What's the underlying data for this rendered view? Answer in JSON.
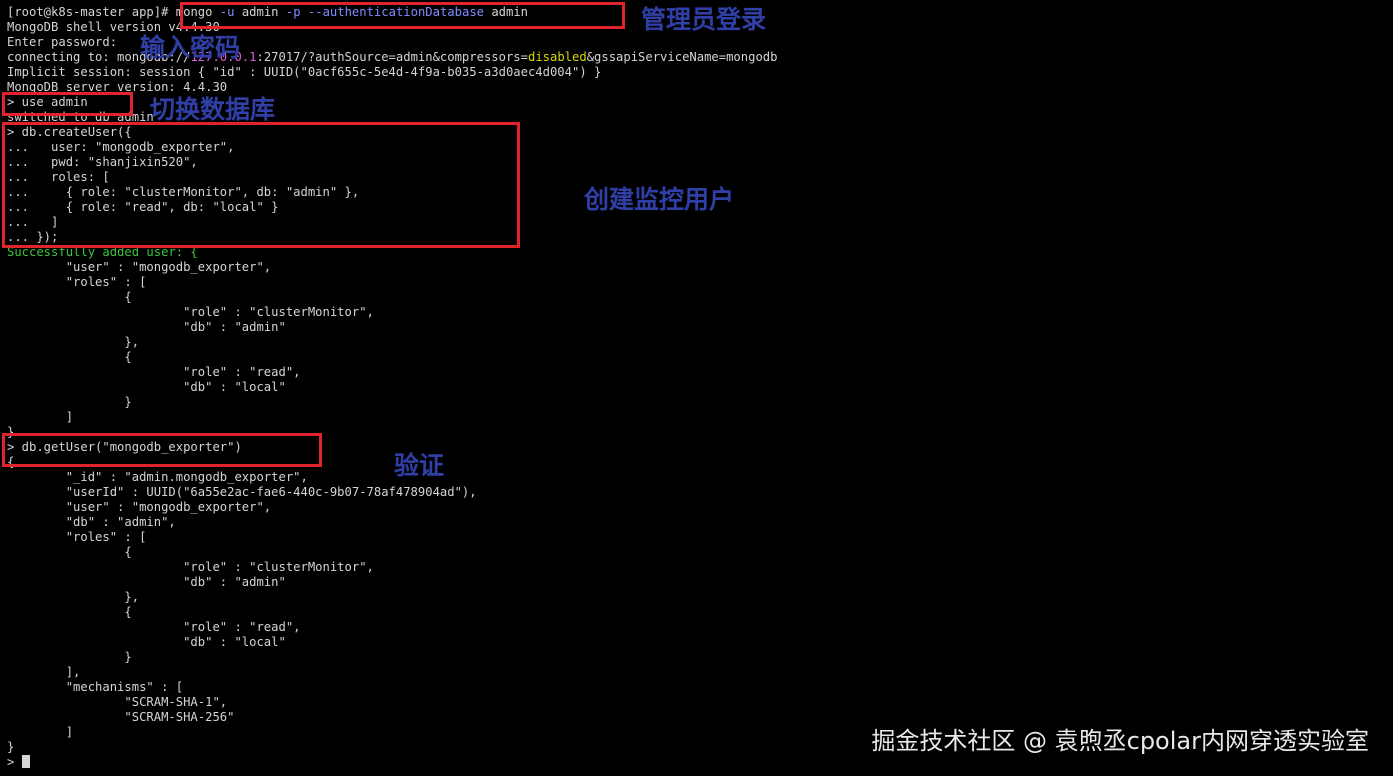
{
  "terminal": {
    "lines": [
      [
        {
          "t": "[root@k8s-master app]# "
        },
        {
          "t": "mongo "
        },
        {
          "t": "-u",
          "c": "blue"
        },
        {
          "t": " admin "
        },
        {
          "t": "-p",
          "c": "blue"
        },
        {
          "t": " "
        },
        {
          "t": "--authenticationDatabase",
          "c": "blue"
        },
        {
          "t": " admin"
        }
      ],
      [
        {
          "t": "MongoDB shell version v4.4.30"
        }
      ],
      [
        {
          "t": "Enter password:"
        }
      ],
      [
        {
          "t": "connecting to: mongodb://"
        },
        {
          "t": "127.0.0.1",
          "c": "magenta"
        },
        {
          "t": ":27017/?authSource=admin&compressors="
        },
        {
          "t": "disabled",
          "c": "yellow"
        },
        {
          "t": "&gssapiServiceName=mongodb"
        }
      ],
      [
        {
          "t": "Implicit session: session { \"id\" : UUID(\"0acf655c-5e4d-4f9a-b035-a3d0aec4d004\") }"
        }
      ],
      [
        {
          "t": "MongoDB server version: 4.4.30"
        }
      ],
      [
        {
          "t": "> use admin"
        }
      ],
      [
        {
          "t": "switched to db admin"
        }
      ],
      [
        {
          "t": "> db.createUser({"
        }
      ],
      [
        {
          "t": "...   user: \"mongodb_exporter\","
        }
      ],
      [
        {
          "t": "...   pwd: \"shanjixin520\","
        }
      ],
      [
        {
          "t": "...   roles: ["
        }
      ],
      [
        {
          "t": "...     { role: \"clusterMonitor\", db: \"admin\" },"
        }
      ],
      [
        {
          "t": "...     { role: \"read\", db: \"local\" }"
        }
      ],
      [
        {
          "t": "...   ]"
        }
      ],
      [
        {
          "t": "... });"
        }
      ],
      [
        {
          "t": "Successfully added user: {",
          "c": "green"
        }
      ],
      [
        {
          "t": "        \"user\" : \"mongodb_exporter\","
        }
      ],
      [
        {
          "t": "        \"roles\" : ["
        }
      ],
      [
        {
          "t": "                {"
        }
      ],
      [
        {
          "t": "                        \"role\" : \"clusterMonitor\","
        }
      ],
      [
        {
          "t": "                        \"db\" : \"admin\""
        }
      ],
      [
        {
          "t": "                },"
        }
      ],
      [
        {
          "t": "                {"
        }
      ],
      [
        {
          "t": "                        \"role\" : \"read\","
        }
      ],
      [
        {
          "t": "                        \"db\" : \"local\""
        }
      ],
      [
        {
          "t": "                }"
        }
      ],
      [
        {
          "t": "        ]"
        }
      ],
      [
        {
          "t": "}"
        }
      ],
      [
        {
          "t": "> db.getUser(\"mongodb_exporter\")"
        }
      ],
      [
        {
          "t": "{"
        }
      ],
      [
        {
          "t": "        \"_id\" : \"admin.mongodb_exporter\","
        }
      ],
      [
        {
          "t": "        \"userId\" : UUID(\"6a55e2ac-fae6-440c-9b07-78af478904ad\"),"
        }
      ],
      [
        {
          "t": "        \"user\" : \"mongodb_exporter\","
        }
      ],
      [
        {
          "t": "        \"db\" : \"admin\","
        }
      ],
      [
        {
          "t": "        \"roles\" : ["
        }
      ],
      [
        {
          "t": "                {"
        }
      ],
      [
        {
          "t": "                        \"role\" : \"clusterMonitor\","
        }
      ],
      [
        {
          "t": "                        \"db\" : \"admin\""
        }
      ],
      [
        {
          "t": "                },"
        }
      ],
      [
        {
          "t": "                {"
        }
      ],
      [
        {
          "t": "                        \"role\" : \"read\","
        }
      ],
      [
        {
          "t": "                        \"db\" : \"local\""
        }
      ],
      [
        {
          "t": "                }"
        }
      ],
      [
        {
          "t": "        ],"
        }
      ],
      [
        {
          "t": "        \"mechanisms\" : ["
        }
      ],
      [
        {
          "t": "                \"SCRAM-SHA-1\","
        }
      ],
      [
        {
          "t": "                \"SCRAM-SHA-256\""
        }
      ],
      [
        {
          "t": "        ]"
        }
      ],
      [
        {
          "t": "}"
        }
      ],
      [
        {
          "t": "> "
        }
      ]
    ],
    "colors": {
      "default": "#d4d4d4",
      "blue": "#7f8cff",
      "magenta": "#d75fd7",
      "yellow": "#d7d700",
      "green": "#3cc23c",
      "background": "#000000"
    }
  },
  "annotations": {
    "login": "管理员登录",
    "password": "输入密码",
    "switch_db": "切换数据库",
    "create_user": "创建监控用户",
    "verify": "验证",
    "color": "#2f3fa6",
    "box_color": "#e0242b"
  },
  "watermark": "掘金技术社区 @ 袁煦丞cpolar内网穿透实验室"
}
